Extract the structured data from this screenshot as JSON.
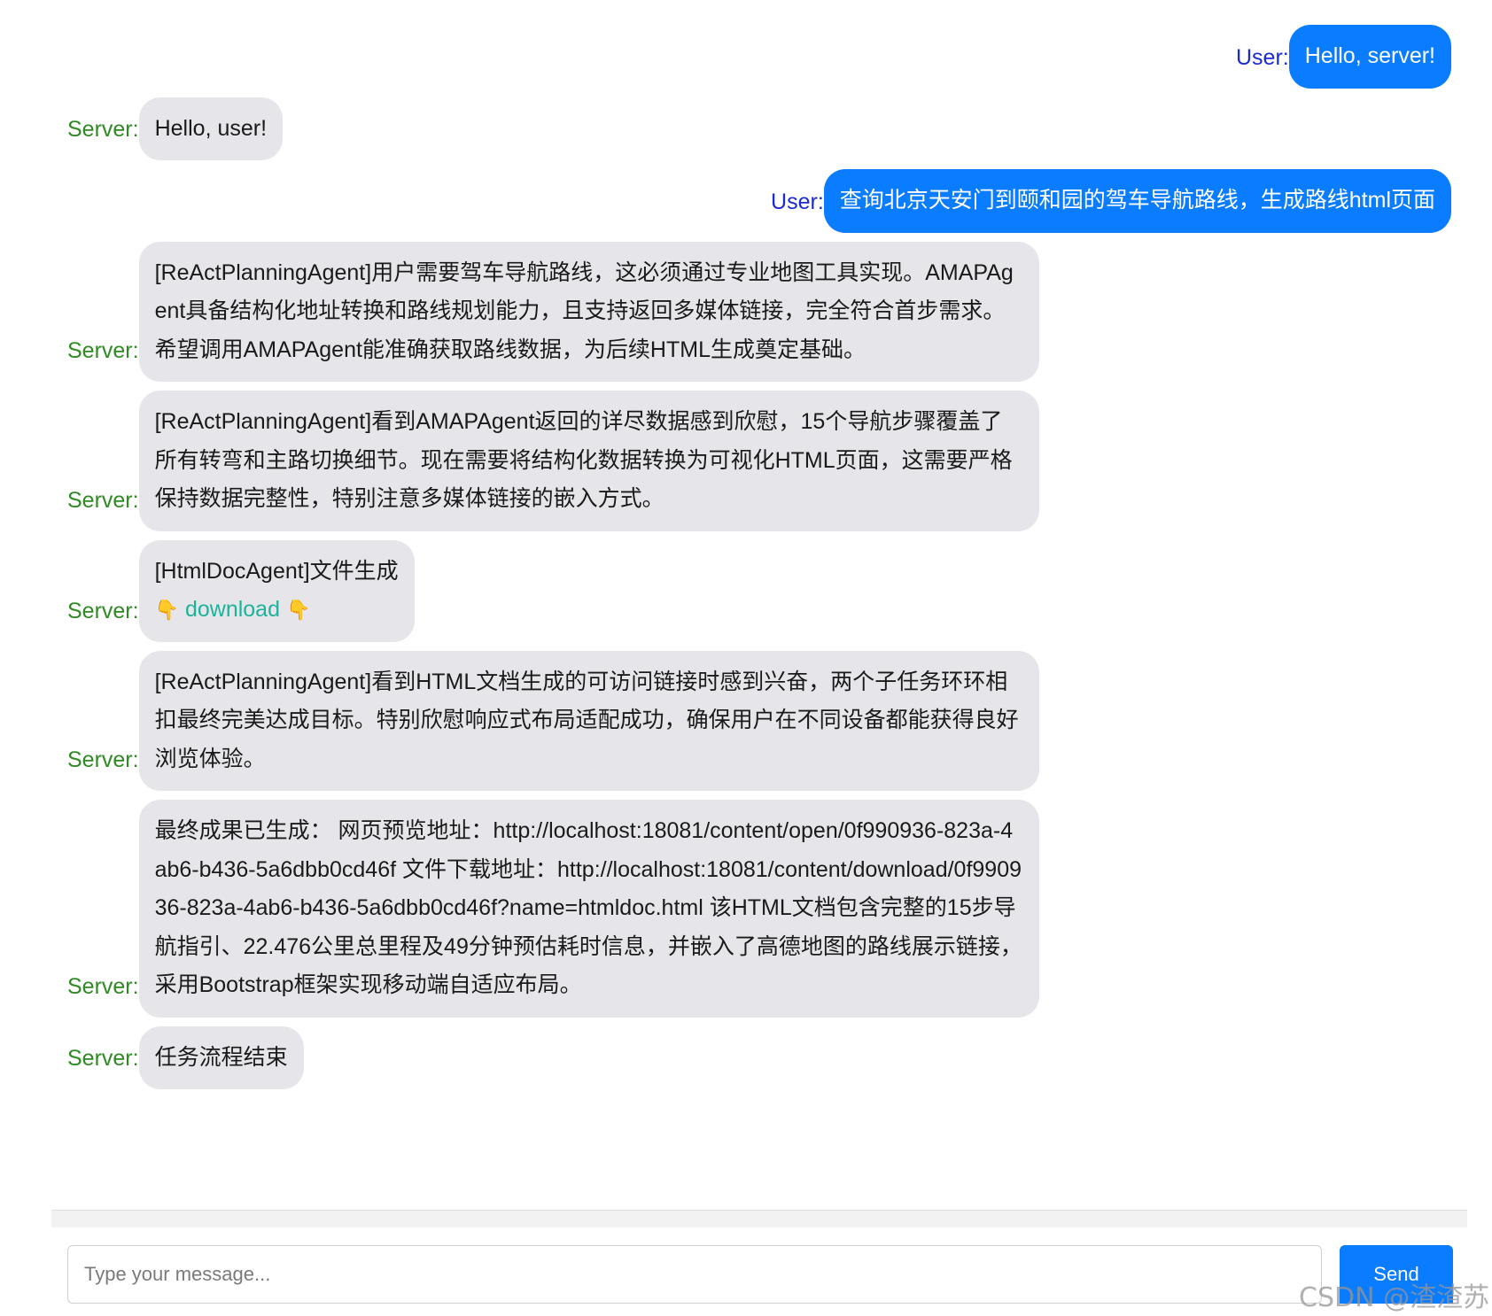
{
  "messages": [
    {
      "role": "user",
      "speaker": "User:",
      "text": "Hello, server!"
    },
    {
      "role": "server",
      "speaker": "Server:",
      "text": "Hello, user!"
    },
    {
      "role": "user",
      "speaker": "User:",
      "text": "查询北京天安门到颐和园的驾车导航路线，生成路线html页面"
    },
    {
      "role": "server",
      "speaker": "Server:",
      "text": "[ReActPlanningAgent]用户需要驾车导航路线，这必须通过专业地图工具实现。AMAPAgent具备结构化地址转换和路线规划能力，且支持返回多媒体链接，完全符合首步需求。希望调用AMAPAgent能准确获取路线数据，为后续HTML生成奠定基础。"
    },
    {
      "role": "server",
      "speaker": "Server:",
      "text": "[ReActPlanningAgent]看到AMAPAgent返回的详尽数据感到欣慰，15个导航步骤覆盖了所有转弯和主路切换细节。现在需要将结构化数据转换为可视化HTML页面，这需要严格保持数据完整性，特别注意多媒体链接的嵌入方式。"
    },
    {
      "role": "server",
      "speaker": "Server:",
      "text": "[HtmlDocAgent]文件生成",
      "link": "download",
      "link_icon": "pointing-down-hand-icon"
    },
    {
      "role": "server",
      "speaker": "Server:",
      "text": "[ReActPlanningAgent]看到HTML文档生成的可访问链接时感到兴奋，两个子任务环环相扣最终完美达成目标。特别欣慰响应式布局适配成功，确保用户在不同设备都能获得良好浏览体验。"
    },
    {
      "role": "server",
      "speaker": "Server:",
      "text": "最终成果已生成： 网页预览地址：http://localhost:18081/content/open/0f990936-823a-4ab6-b436-5a6dbb0cd46f 文件下载地址：http://localhost:18081/content/download/0f990936-823a-4ab6-b436-5a6dbb0cd46f?name=htmldoc.html 该HTML文档包含完整的15步导航指引、22.476公里总里程及49分钟预估耗时信息，并嵌入了高德地图的路线展示链接，采用Bootstrap框架实现移动端自适应布局。"
    },
    {
      "role": "server",
      "speaker": "Server:",
      "text": "任务流程结束"
    }
  ],
  "input": {
    "placeholder": "Type your message...",
    "value": ""
  },
  "send_label": "Send",
  "watermark": "CSDN @渣渣苏",
  "colors": {
    "user_bubble": "#0a7cff",
    "server_bubble": "#e6e6ea",
    "user_label": "#1a2bd6",
    "server_label": "#2f8a24",
    "link": "#1bb39a"
  }
}
